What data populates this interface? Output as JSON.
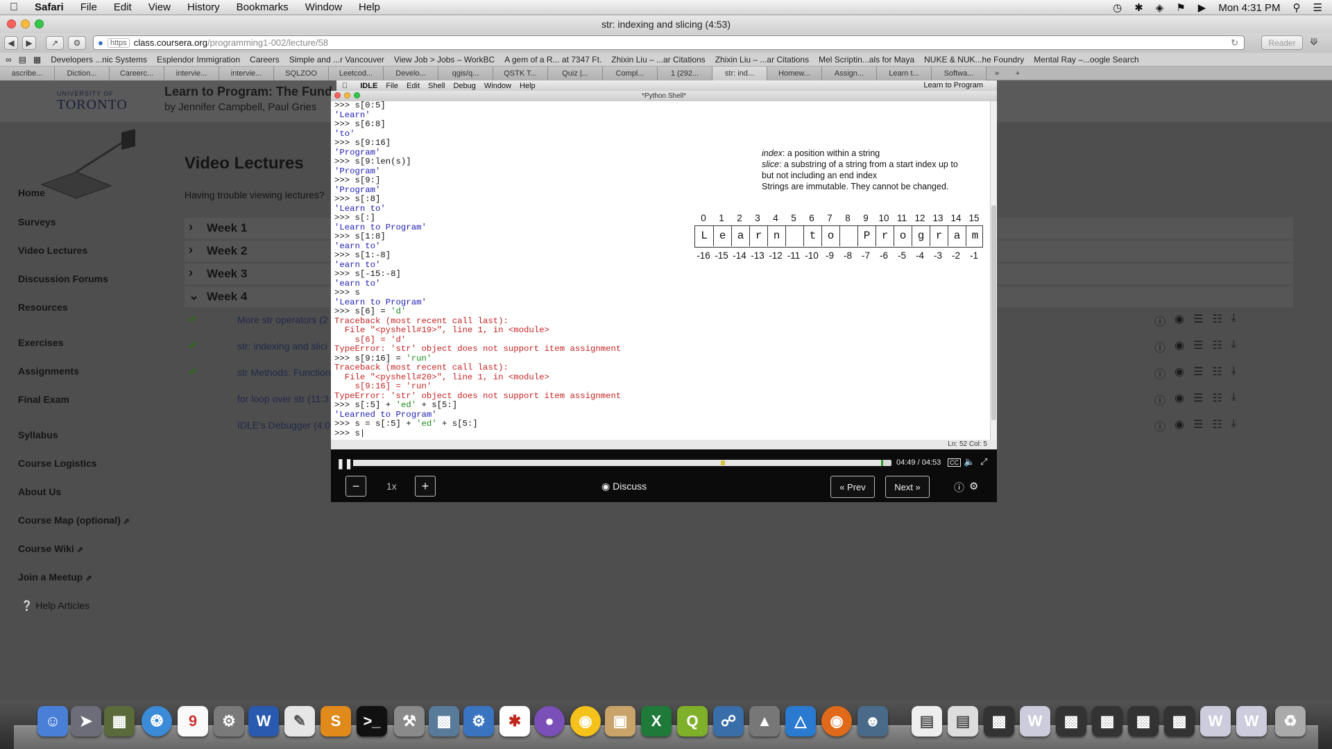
{
  "menubar": {
    "items": [
      "Safari",
      "File",
      "Edit",
      "View",
      "History",
      "Bookmarks",
      "Window",
      "Help"
    ],
    "clock": "Mon 4:31 PM"
  },
  "window": {
    "title": "str: indexing and slicing (4:53)"
  },
  "address": {
    "scheme": "https",
    "host": "class.coursera.org",
    "path": "/programming1-002/lecture/58",
    "reader": "Reader"
  },
  "bookmarks": [
    "Developers ...nic Systems",
    "Esplendor Immigration",
    "Careers",
    "Simple and ...r Vancouver",
    "View Job > Jobs – WorkBC",
    "A gem of a R... at 7347 Ft.",
    "Zhixin Liu – ...ar Citations",
    "Zhixin Liu – ...ar Citations",
    "Mel Scriptin...als for Maya",
    "NUKE & NUK...he Foundry",
    "Mental Ray –...oogle Search"
  ],
  "tabs": [
    "ascribe...",
    "Diction...",
    "Careerc...",
    "intervie...",
    "intervie...",
    "SQLZOO",
    "Leetcod...",
    "Develo...",
    "qgis/q...",
    "QSTK T...",
    "Quiz |...",
    "Compl...",
    "1 (292...",
    "str: ind...",
    "Homew...",
    "Assign...",
    "Learn t...",
    "Softwa..."
  ],
  "header": {
    "university_small": "UNIVERSITY OF",
    "university_big": "TORONTO",
    "course_title": "Learn to Program: The Fund",
    "course_by": "by Jennifer Campbell, Paul Gries"
  },
  "sidebar": {
    "items": [
      "Home",
      "Surveys",
      "Video Lectures",
      "Discussion Forums",
      "Resources",
      "Exercises",
      "Assignments",
      "Final Exam",
      "Syllabus",
      "Course Logistics",
      "About Us",
      "Course Map (optional)",
      "Course Wiki",
      "Join a Meetup"
    ],
    "help": "Help Articles"
  },
  "main": {
    "title": "Video Lectures",
    "trouble": "Having trouble viewing lectures?",
    "weeks": [
      "Week 1",
      "Week 2",
      "Week 3",
      "Week 4"
    ],
    "lectures": [
      "More str operators (2",
      "str: indexing and slici",
      "str Methods: Function",
      "for loop over str (11:3",
      "IDLE's Debugger (4:0"
    ]
  },
  "idle": {
    "menu": [
      "IDLE",
      "File",
      "Edit",
      "Shell",
      "Debug",
      "Window",
      "Help"
    ],
    "right": "Learn to Program",
    "shell_title": "*Python Shell*",
    "status": "Ln: 52 Col: 5"
  },
  "slide": {
    "def_index_term": "index",
    "def_index_text": ": a position within a string",
    "def_slice_term": "slice",
    "def_slice_text": ": a substring of a string from a start index up to",
    "def_slice_text2": "but not including an end index",
    "immutable": "Strings are immutable. They cannot be changed.",
    "pos_idx": [
      "0",
      "1",
      "2",
      "3",
      "4",
      "5",
      "6",
      "7",
      "8",
      "9",
      "10",
      "11",
      "12",
      "13",
      "14",
      "15"
    ],
    "chars": [
      "L",
      "e",
      "a",
      "r",
      "n",
      " ",
      "t",
      "o",
      " ",
      "P",
      "r",
      "o",
      "g",
      "r",
      "a",
      "m"
    ],
    "neg_idx": [
      "-16",
      "-15",
      "-14",
      "-13",
      "-12",
      "-11",
      "-10",
      "-9",
      "-8",
      "-7",
      "-6",
      "-5",
      "-4",
      "-3",
      "-2",
      "-1"
    ]
  },
  "video": {
    "time": "04:49 / 04:53",
    "progress": 0.985,
    "speed": "1x",
    "discuss": "Discuss",
    "prev": "« Prev",
    "next": "Next »"
  },
  "colors": {
    "prompt": "#111111",
    "output": "#1a1ab0",
    "error": "#c42222",
    "string": "#1b8a1b"
  }
}
